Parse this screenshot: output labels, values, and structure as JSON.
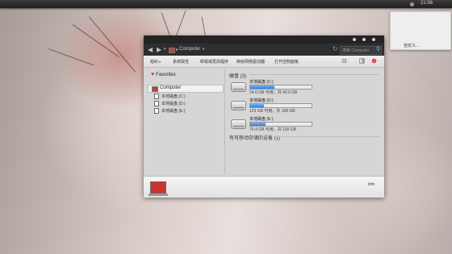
{
  "top_panel": {
    "clock": "21:56"
  },
  "desktop_popup": {
    "item": "自定义..."
  },
  "window": {
    "address": {
      "root": "Computer"
    },
    "search": {
      "placeholder": "搜索 Computer"
    },
    "toolbar": {
      "organize": "组织",
      "system_properties": "系统属性",
      "uninstall": "卸载或更改程序",
      "map_drive": "映射网络驱动器",
      "control_panel": "打开控制面板"
    },
    "sidebar": {
      "favorites": "Favorites",
      "computer": "Computer",
      "drives": [
        "本地磁盘 (C:)",
        "本地磁盘 (D:)",
        "本地磁盘 (E:)"
      ]
    },
    "content": {
      "hdd_header": "硬盘 (3)",
      "drives": [
        {
          "name": "本地磁盘 (C:)",
          "free": "24.6 GB 可用，共 40.0 GB",
          "used_fraction": 0.39
        },
        {
          "name": "本地磁盘 (D:)",
          "free": "123 GB 可用，共 158 GB",
          "used_fraction": 0.22
        },
        {
          "name": "本地磁盘 (E:)",
          "free": "75.4 GB 可用，共 100 GB",
          "used_fraction": 0.25
        }
      ],
      "removable_header": "有可移动存储的设备 (1)"
    },
    "details": {
      "info": "Info"
    }
  }
}
